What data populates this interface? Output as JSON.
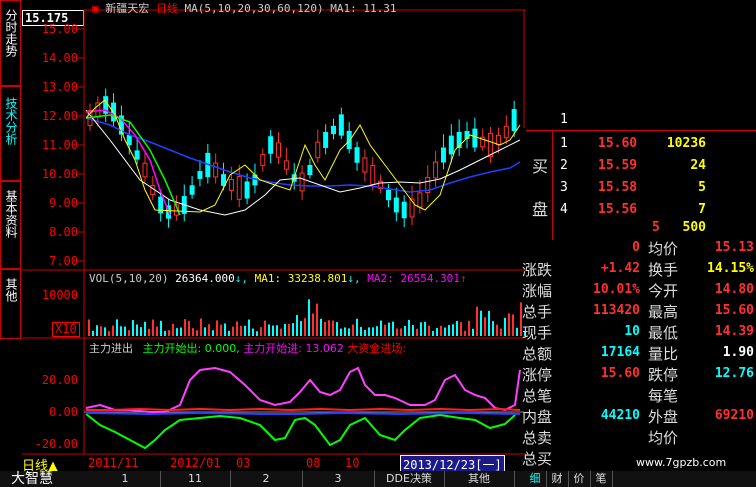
{
  "sidebar": {
    "price_box": "15.175",
    "tabs": [
      {
        "label": "分时走势"
      },
      {
        "label": "技术分析"
      },
      {
        "label": "基本资料"
      },
      {
        "label": "其他"
      }
    ]
  },
  "chart_header": {
    "stock_name": "新疆天宏",
    "period": "日线",
    "ma_params": "MA(5,10,20,30,60,120)",
    "ma1_label": "MA1:",
    "ma1_value": "11.31"
  },
  "y_axis_labels": [
    "15.00",
    "14.00",
    "13.00",
    "12.00",
    "11.00",
    "10.00",
    "9.00",
    "8.00",
    "7.00"
  ],
  "volume": {
    "header": "VOL(5,10,20)",
    "vol_value": "26364.000",
    "ma1_label": "MA1:",
    "ma1_value": "33238.801",
    "ma2_label": "MA2:",
    "ma2_value": "26554.301",
    "y_label": "10000",
    "unit_label": "X10"
  },
  "capital_flow": {
    "title": "主力进出",
    "out_label": "主力开始出:",
    "out_value": "0.000,",
    "in_label": "主力开始进:",
    "in_value": "13.062",
    "big_label": "大资金进场:",
    "y_labels": [
      "20.00",
      "0.00",
      "-20.00"
    ]
  },
  "date_axis": {
    "period": "日线",
    "labels": [
      "2011/11",
      "2012/01",
      "03",
      "08",
      "10"
    ],
    "cursor_date": "2013/12/23[一]"
  },
  "bottom_tabs": [
    "大智慧",
    "1",
    "11",
    "2",
    "3",
    "DDE决策",
    "其他",
    "细",
    "财",
    "价",
    "笔"
  ],
  "watermark": "www.7gpzb.com",
  "order_book": {
    "side_buy": "买",
    "side_plate": "盘",
    "top_index": "1",
    "rows": [
      {
        "idx": "1",
        "price": "15.60",
        "vol": "10236"
      },
      {
        "idx": "2",
        "price": "15.59",
        "vol": "24"
      },
      {
        "idx": "3",
        "price": "15.58",
        "vol": "5"
      },
      {
        "idx": "4",
        "price": "15.56",
        "vol": "7"
      },
      {
        "idx": "",
        "price": "5",
        "vol": "500"
      }
    ]
  },
  "quote": {
    "left": [
      {
        "label": "",
        "value": "0"
      },
      {
        "label": "涨跌",
        "value": "+1.42"
      },
      {
        "label": "涨幅",
        "value": "10.01%"
      },
      {
        "label": "总手",
        "value": "113420"
      },
      {
        "label": "现手",
        "value": "10"
      },
      {
        "label": "总额",
        "value": "17164"
      },
      {
        "label": "涨停",
        "value": "15.60"
      },
      {
        "label": "总笔",
        "value": ""
      },
      {
        "label": "内盘",
        "value": "44210"
      },
      {
        "label": "总卖",
        "value": ""
      },
      {
        "label": "总买",
        "value": ""
      }
    ],
    "right": [
      {
        "label": "均价",
        "value": "15.13"
      },
      {
        "label": "换手",
        "value": "14.15%"
      },
      {
        "label": "今开",
        "value": "14.80"
      },
      {
        "label": "最高",
        "value": "15.60"
      },
      {
        "label": "最低",
        "value": "14.39"
      },
      {
        "label": "量比",
        "value": "1.90"
      },
      {
        "label": "跌停",
        "value": "12.76"
      },
      {
        "label": "每笔",
        "value": ""
      },
      {
        "label": "外盘",
        "value": "69210"
      },
      {
        "label": "均价",
        "value": ""
      }
    ]
  },
  "colors": {
    "up": "#ff3030",
    "down": "#00ffff",
    "ma5": "#ffffff",
    "ma10": "#ffff00",
    "ma20": "#ff00ff",
    "ma30": "#00ff00",
    "ma60": "#3050ff",
    "ma120": "#ff0000"
  }
}
